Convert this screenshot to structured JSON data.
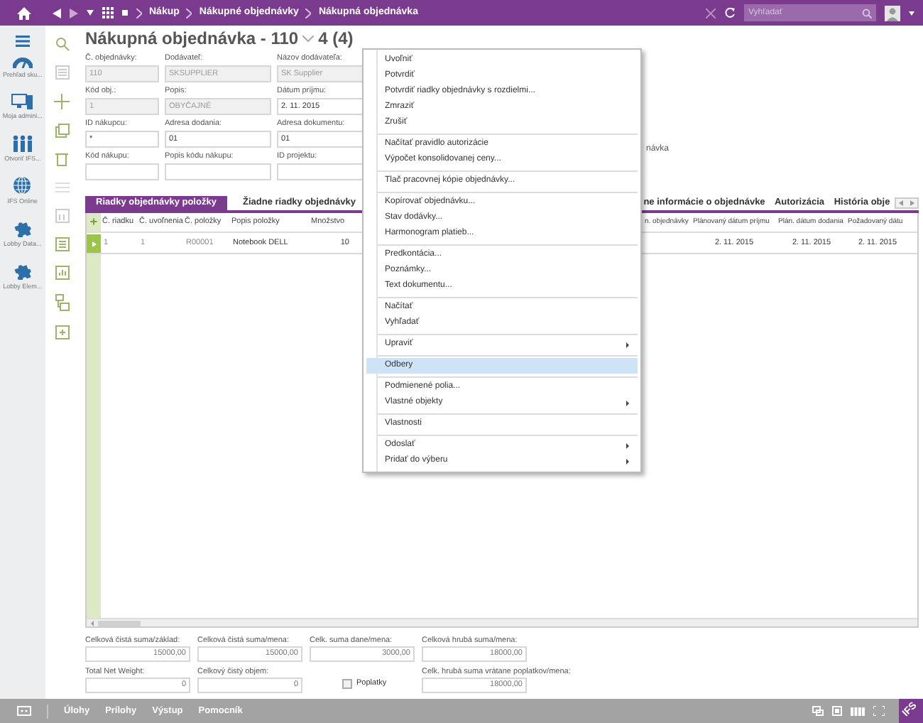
{
  "top_bar": {
    "breadcrumb": [
      "Nákup",
      "Nákupné objednávky",
      "Nákupná objednávka"
    ],
    "search": {
      "placeholder": "Vyhľadať"
    }
  },
  "sidebar": {
    "items": [
      {
        "label": "Prehľad sku..."
      },
      {
        "label": "Moja admini..."
      },
      {
        "label": "Otvoriť IFS..."
      },
      {
        "label": "IFS Online"
      },
      {
        "label": "Lobby Data..."
      },
      {
        "label": "Lobby Elem..."
      }
    ]
  },
  "header": {
    "title": "Nákupná objednávka - 110",
    "count": "4 (4)"
  },
  "form": {
    "rows": [
      [
        {
          "label": "Č. objednávky:",
          "value": "110",
          "disabled": true
        },
        {
          "label": "Dodávateľ:",
          "value": "SKSUPPLIER",
          "disabled": true
        },
        {
          "label": "Názov dodávateľa:",
          "value": "SK Supplier",
          "disabled": true
        }
      ],
      [
        {
          "label": "Kód obj.:",
          "value": "1",
          "disabled": true
        },
        {
          "label": "Popis:",
          "value": "OBYČAJNÉ",
          "disabled": true
        },
        {
          "label": "Dátum príjmu:",
          "value": "2. 11. 2015",
          "disabled": false
        }
      ],
      [
        {
          "label": "ID nákupcu:",
          "value": "*",
          "disabled": false
        },
        {
          "label": "Adresa dodania:",
          "value": "01",
          "disabled": false
        },
        {
          "label": "Adresa dokumentu:",
          "value": "01",
          "disabled": false
        }
      ],
      [
        {
          "label": "Kód nákupu:",
          "disabled": false
        },
        {
          "label": "Popis kódu nákupu:",
          "disabled": false
        },
        {
          "label": "ID projektu:",
          "disabled": false
        }
      ]
    ],
    "partial_label": "návka"
  },
  "tabs": [
    {
      "label": "Riadky objednávky položky",
      "selected": true
    },
    {
      "label": "Žiadne riadky objednávky",
      "selected": false
    },
    {
      "label": "ne informácie o objednávke",
      "selected": false
    },
    {
      "label": "Autorizácia",
      "selected": false
    },
    {
      "label": "História obje",
      "selected": false
    }
  ],
  "table": {
    "add": "+",
    "columns": [
      "Č. riadku",
      "Č. uvoľnenia",
      "Č. položky",
      "Popis položky",
      "Množstvo",
      "n. objednávky",
      "Plánovaný dátum príjmu",
      "Plán. dátum dodania",
      "Požadovaný dátu"
    ],
    "rows": [
      {
        "selected": true,
        "cells": [
          "1",
          "1",
          "R00001",
          "Notebook DELL",
          "10",
          "",
          "2. 11. 2015",
          "2. 11. 2015",
          "2. 11. 2015"
        ]
      }
    ]
  },
  "totals": {
    "fields": [
      {
        "label": "Celková čistá suma/základ:",
        "value": "15000,00"
      },
      {
        "label": "Celková čistá suma/mena:",
        "value": "15000,00"
      },
      {
        "label": "Celk. suma dane/mena:",
        "value": "3000,00"
      },
      {
        "label": "Celková hrubá suma/mena:",
        "value": "18000,00"
      },
      {
        "label": "Total Net Weight:",
        "value": "0"
      },
      {
        "label": "Celkový čistý objem:",
        "value": "0"
      },
      {
        "label": "Celk. hrubá suma vrátane poplatkov/mena:",
        "value": "18000,00"
      }
    ],
    "checkbox": {
      "label": "Poplatky",
      "checked": false
    }
  },
  "context_menu": {
    "groups": [
      [
        {
          "label": "Uvoľniť",
          "submenu": false,
          "selected": false
        },
        {
          "label": "Potvrdiť",
          "submenu": false,
          "selected": false
        },
        {
          "label": "Potvrdiť riadky objednávky s rozdielmi...",
          "submenu": false,
          "selected": false
        },
        {
          "label": "Zmraziť",
          "submenu": false,
          "selected": false
        },
        {
          "label": "Zrušiť",
          "submenu": false,
          "selected": false
        }
      ],
      [
        {
          "label": "Načítať pravidlo autorizácie",
          "submenu": false,
          "selected": false
        },
        {
          "label": "Výpočet konsolidovanej ceny...",
          "submenu": false,
          "selected": false
        }
      ],
      [
        {
          "label": "Tlač pracovnej kópie objednávky...",
          "submenu": false,
          "selected": false
        }
      ],
      [
        {
          "label": "Kopírovať objednávku...",
          "submenu": false,
          "selected": false
        },
        {
          "label": "Stav dodávky...",
          "submenu": false,
          "selected": false
        },
        {
          "label": "Harmonogram platieb...",
          "submenu": false,
          "selected": false
        }
      ],
      [
        {
          "label": "Predkontácia...",
          "submenu": false,
          "selected": false
        },
        {
          "label": "Poznámky...",
          "submenu": false,
          "selected": false
        },
        {
          "label": "Text dokumentu...",
          "submenu": false,
          "selected": false
        }
      ],
      [
        {
          "label": "Načítať",
          "submenu": false,
          "selected": false
        },
        {
          "label": "Vyhľadať",
          "submenu": false,
          "selected": false
        }
      ],
      [
        {
          "label": "Upraviť",
          "submenu": true,
          "selected": false
        }
      ],
      [
        {
          "label": "Odbery",
          "submenu": false,
          "selected": true
        }
      ],
      [
        {
          "label": "Podmienené polia...",
          "submenu": false,
          "selected": false
        },
        {
          "label": "Vlastné objekty",
          "submenu": true,
          "selected": false
        }
      ],
      [
        {
          "label": "Vlastnosti",
          "submenu": false,
          "selected": false
        }
      ],
      [
        {
          "label": "Odoslať",
          "submenu": true,
          "selected": false
        },
        {
          "label": "Pridať do výberu",
          "submenu": true,
          "selected": false
        }
      ]
    ]
  },
  "bottom_bar": {
    "links": [
      "Úlohy",
      "Prílohy",
      "Výstup",
      "Pomocník"
    ],
    "logo": "IFS"
  }
}
